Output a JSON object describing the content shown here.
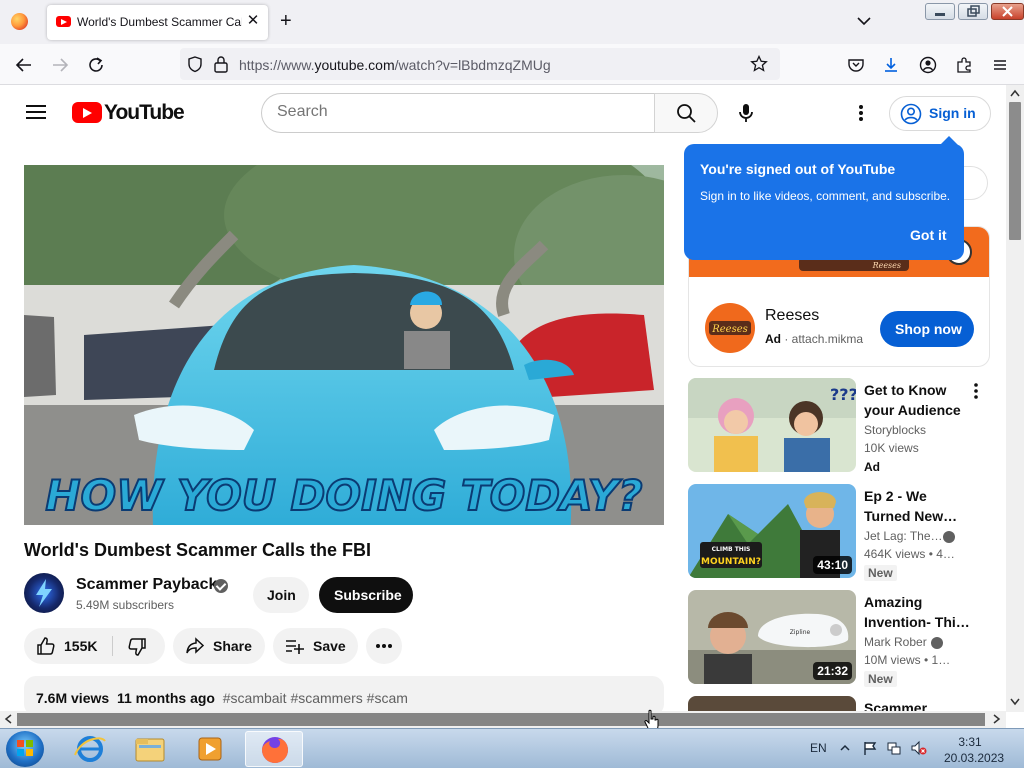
{
  "browser": {
    "tab_title": "World's Dumbest Scammer Calls the FBI",
    "url_prefix": "https://www.",
    "url_domain": "youtube.com",
    "url_path": "/watch?v=lBbdmzqZMUg"
  },
  "header": {
    "logo_text": "YouTube",
    "search_placeholder": "Search",
    "signin_label": "Sign in"
  },
  "signin_tooltip": {
    "heading": "You're signed out of YouTube",
    "body": "Sign in to like videos, comment, and subscribe.",
    "button": "Got it"
  },
  "video": {
    "overlay_text": "HOW YOU DOING TODAY?",
    "title": "World's Dumbest Scammer Calls the FBI",
    "channel_name": "Scammer Payback",
    "subscribers": "5.49M subscribers",
    "join_label": "Join",
    "subscribe_label": "Subscribe",
    "likes": "155K",
    "share_label": "Share",
    "save_label": "Save",
    "views": "7.6M views",
    "age": "11 months ago",
    "hashtags": "#scambait #scammers #scam"
  },
  "ad": {
    "advertiser": "Reeses",
    "ad_label": "Ad",
    "domain": "attach.mikma",
    "cta": "Shop now",
    "banner_text": "Reeses"
  },
  "recommendations": [
    {
      "title": "Get to Know your Audience",
      "channel": "Storyblocks",
      "views": "10K views",
      "badge": "Ad",
      "duration": ""
    },
    {
      "title": "Ep 2 - We Turned New…",
      "channel": "Jet Lag: The…",
      "views": "464K views  • 4…",
      "badge": "New",
      "duration": "43:10",
      "thumb_text": "CLIMB THIS MOUNTAIN?"
    },
    {
      "title": "Amazing Invention- Thi…",
      "channel": "Mark Rober",
      "views": "10M views  • 1…",
      "badge": "New",
      "duration": "21:32",
      "thumb_text": "Zipline"
    },
    {
      "title": "Scammer",
      "channel": "",
      "views": "",
      "badge": "",
      "duration": ""
    }
  ],
  "taskbar": {
    "language": "EN",
    "time": "3:31",
    "date": "20.03.2023"
  }
}
